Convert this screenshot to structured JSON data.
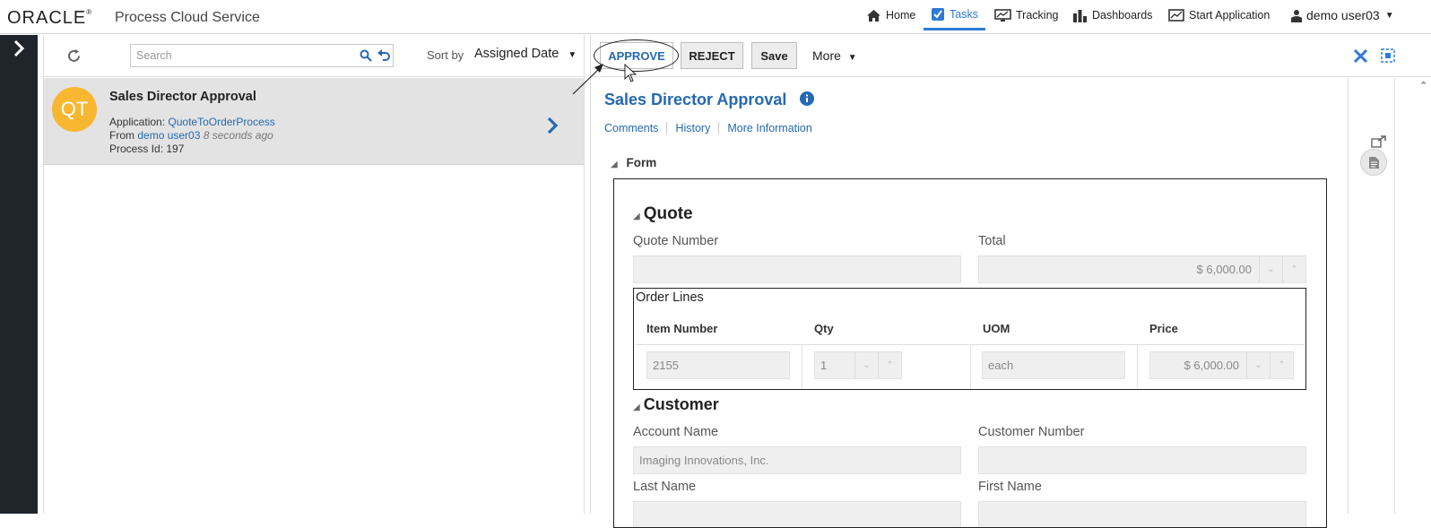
{
  "header": {
    "brand": "ORACLE",
    "product": "Process Cloud Service",
    "nav": [
      {
        "label": "Home",
        "icon": "home-icon"
      },
      {
        "label": "Tasks",
        "icon": "tasks-icon",
        "active": true
      },
      {
        "label": "Tracking",
        "icon": "tracking-icon"
      },
      {
        "label": "Dashboards",
        "icon": "dashboards-icon"
      },
      {
        "label": "Start Application",
        "icon": "start-application-icon"
      }
    ],
    "user": "demo user03"
  },
  "tasklist": {
    "search_placeholder": "Search",
    "sort_label": "Sort by",
    "sort_value": "Assigned Date",
    "items": [
      {
        "avatar": "QT",
        "title": "Sales Director Approval",
        "application_label": "Application:",
        "application": "QuoteToOrderProcess",
        "from_label": "From",
        "from_user": "demo user03",
        "time": "8 seconds ago",
        "process_id": "Process Id: 197"
      }
    ]
  },
  "detail": {
    "toolbar": {
      "approve": "APPROVE",
      "reject": "REJECT",
      "save": "Save",
      "more": "More"
    },
    "title": "Sales Director Approval",
    "tabs": [
      "Comments",
      "History",
      "More Information"
    ],
    "form_label": "Form",
    "quote": {
      "section": "Quote",
      "quote_number_label": "Quote Number",
      "quote_number_value": "",
      "total_label": "Total",
      "total_value": "$ 6,000.00"
    },
    "order_lines": {
      "title": "Order Lines",
      "columns": [
        "Item Number",
        "Qty",
        "UOM",
        "Price"
      ],
      "rows": [
        {
          "item_number": "2155",
          "qty": "1",
          "uom": "each",
          "price": "$ 6,000.00"
        }
      ]
    },
    "customer": {
      "section": "Customer",
      "account_name_label": "Account Name",
      "account_name_value": "Imaging Innovations, Inc.",
      "customer_number_label": "Customer Number",
      "customer_number_value": "",
      "last_name_label": "Last Name",
      "first_name_label": "First Name"
    }
  },
  "colors": {
    "accent": "#2569b3",
    "avatar": "#f7b731",
    "rail": "#20252b",
    "close": "#2d7bd4"
  }
}
